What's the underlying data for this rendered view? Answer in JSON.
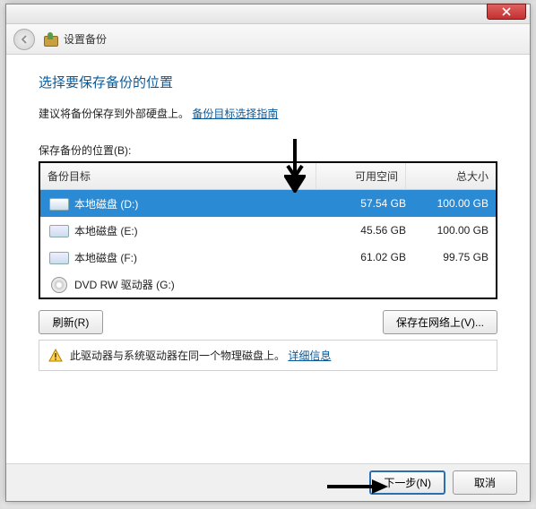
{
  "window": {
    "title": "设置备份"
  },
  "heading": "选择要保存备份的位置",
  "subtitle_prefix": "建议将备份保存到外部硬盘上。",
  "subtitle_link": "备份目标选择指南",
  "section_label": "保存备份的位置(B):",
  "columns": {
    "target": "备份目标",
    "free": "可用空间",
    "total": "总大小"
  },
  "drives": [
    {
      "name": "本地磁盘 (D:)",
      "free": "57.54 GB",
      "total": "100.00 GB",
      "type": "disk",
      "selected": true
    },
    {
      "name": "本地磁盘 (E:)",
      "free": "45.56 GB",
      "total": "100.00 GB",
      "type": "disk",
      "selected": false
    },
    {
      "name": "本地磁盘 (F:)",
      "free": "61.02 GB",
      "total": "99.75 GB",
      "type": "disk",
      "selected": false
    },
    {
      "name": "DVD RW 驱动器 (G:)",
      "free": "",
      "total": "",
      "type": "dvd",
      "selected": false
    }
  ],
  "buttons": {
    "refresh": "刷新(R)",
    "save_network": "保存在网络上(V)...",
    "next": "下一步(N)",
    "cancel": "取消"
  },
  "warning": {
    "text": "此驱动器与系统驱动器在同一个物理磁盘上。",
    "link": "详细信息"
  }
}
